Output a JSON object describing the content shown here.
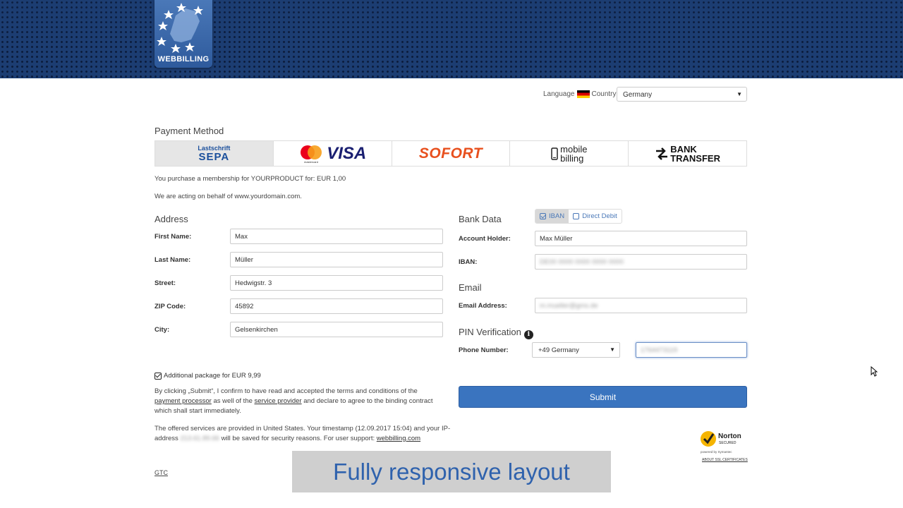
{
  "header": {
    "logo_text": "WEBBILLING"
  },
  "locale": {
    "language_label": "Language",
    "country_label": "Country",
    "country_value": "Germany"
  },
  "payment": {
    "title": "Payment Method",
    "methods": [
      {
        "name": "Lastschrift SEPA",
        "line1": "Lastschrift",
        "line2": "SEPA",
        "active": true
      },
      {
        "name": "Mastercard / VISA",
        "mc_sub": "mastercard",
        "visa": "VISA"
      },
      {
        "name": "SOFORT",
        "text": "SOFORT"
      },
      {
        "name": "mobile billing",
        "line1": "mobile",
        "line2": "billing"
      },
      {
        "name": "BANK TRANSFER",
        "line1": "BANK",
        "line2": "TRANSFER"
      }
    ],
    "purchase_text": "You purchase a membership for YOURPRODUCT for: EUR 1,00",
    "behalf_text": "We are acting on behalf of www.yourdomain.com."
  },
  "address": {
    "title": "Address",
    "fields": [
      {
        "label": "First Name:",
        "value": "Max"
      },
      {
        "label": "Last Name:",
        "value": "Müller"
      },
      {
        "label": "Street:",
        "value": "Hedwigstr. 3"
      },
      {
        "label": "ZIP Code:",
        "value": "45892"
      },
      {
        "label": "City:",
        "value": "Gelsenkirchen"
      }
    ]
  },
  "bank": {
    "title": "Bank Data",
    "toggle_iban": "IBAN",
    "toggle_direct": "Direct Debit",
    "holder_label": "Account Holder:",
    "holder_value": "Max Müller",
    "iban_label": "IBAN:",
    "iban_value": "DE00 0000 0000 0000 0000"
  },
  "email": {
    "title": "Email",
    "label": "Email Address:",
    "value": "m.mueller@gmx.de"
  },
  "pin": {
    "title": "PIN Verification",
    "phone_label": "Phone Number:",
    "country_code": "+49 Germany",
    "phone_value": "1764473119"
  },
  "addon": {
    "text": "Additional package for EUR 9,99",
    "checked": true
  },
  "terms": {
    "part1": "By clicking „Submit“, I confirm to have read and accepted the terms and conditions of the",
    "link1": "payment processor",
    "part2": "as well of the",
    "link2": "service provider",
    "part3": "and declare to agree to the binding contract which shall start immediately."
  },
  "services": {
    "part1": "The offered services are provided in United States. Your timestamp (12.09.2017 15:04) and your IP-address",
    "ip": "213.61.89.66",
    "part2": "will be saved for security reasons. For user support:",
    "support_link": "webbilling.com"
  },
  "submit_label": "Submit",
  "gtc_label": "GTC",
  "norton": {
    "line1": "Norton",
    "line2": "SECURED",
    "powered": "powered by Symantec",
    "about": "ABOUT SSL CERTIFICATES"
  },
  "overlay_text": "Fully responsive layout",
  "colors": {
    "header_bg": "#1c3d72",
    "accent": "#3a74bf",
    "sofort": "#e8501e",
    "mastercard_red": "#eb001b",
    "mastercard_yellow": "#f79e1b",
    "visa_blue": "#1a1f71"
  }
}
